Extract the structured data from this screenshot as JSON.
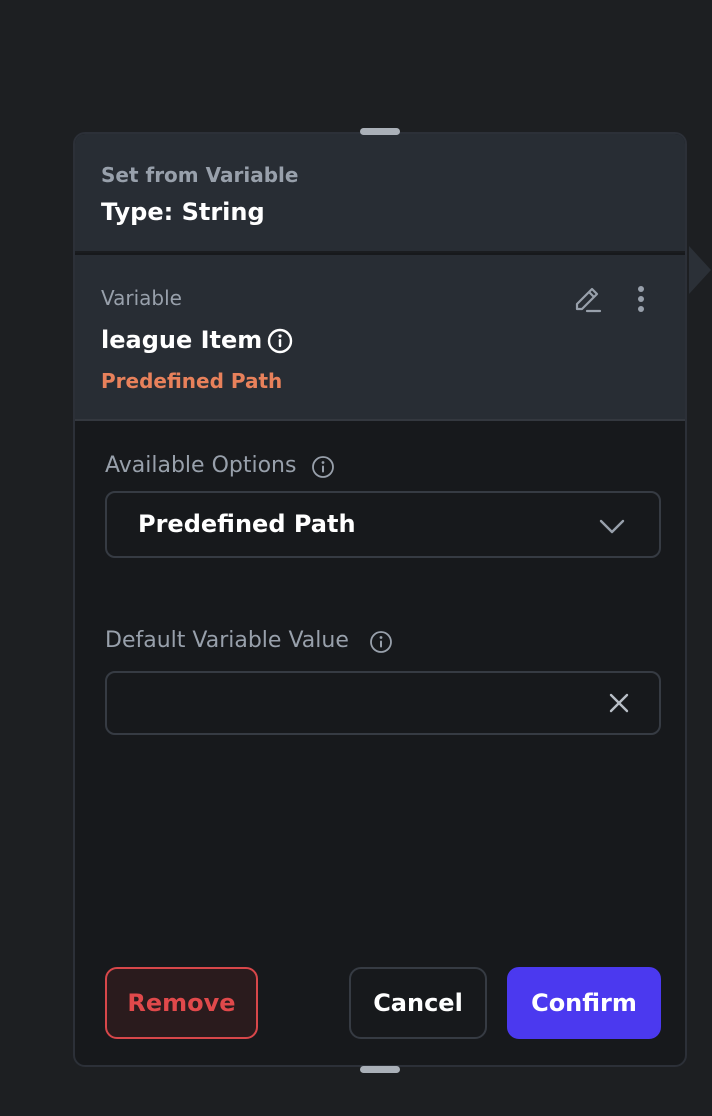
{
  "header": {
    "subtitle": "Set from Variable",
    "title": "Type: String"
  },
  "variable": {
    "label": "Variable",
    "name": "league Item",
    "source": "Predefined Path",
    "icons": [
      "edit-icon",
      "more-vertical-icon",
      "info-icon"
    ]
  },
  "available_options": {
    "label": "Available Options",
    "selected": "Predefined Path"
  },
  "default_value": {
    "label": "Default Variable Value",
    "value": ""
  },
  "actions": {
    "remove": "Remove",
    "cancel": "Cancel",
    "confirm": "Confirm"
  },
  "colors": {
    "accent": "#4b39ef",
    "danger": "#e0494b",
    "path": "#e8815b"
  }
}
